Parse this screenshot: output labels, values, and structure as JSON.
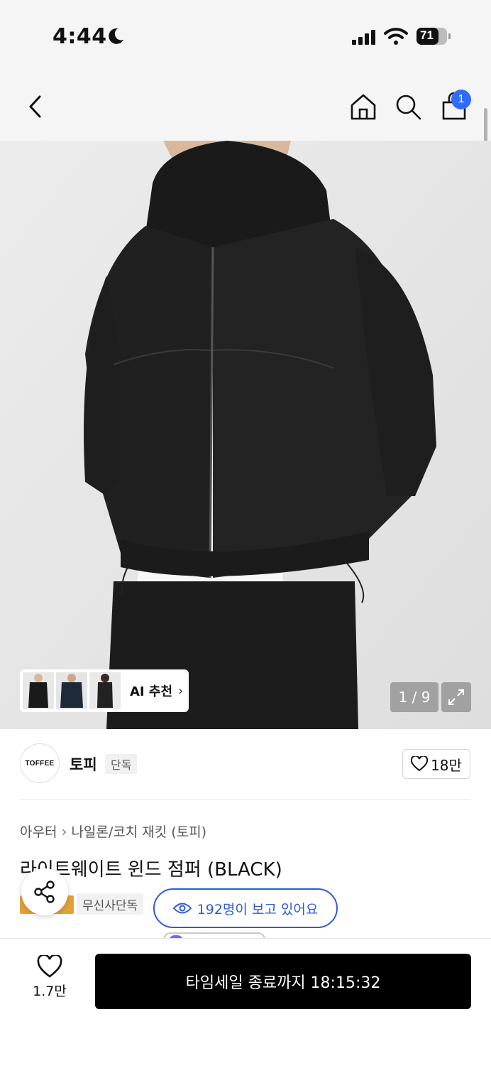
{
  "status_bar": {
    "time": "4:44",
    "battery": "71"
  },
  "header": {
    "cart_count": "1"
  },
  "gallery": {
    "counter": "1 / 9",
    "ai_recommend_label": "AI 추천"
  },
  "brand": {
    "logo_text": "TOFFEE",
    "name": "토피",
    "tag": "단독",
    "likes": "18만"
  },
  "product": {
    "breadcrumb": [
      "아우터",
      "나일론/코치 재킷 (토피)"
    ],
    "title": "라이트웨이트 윈드 점퍼 (BLACK)",
    "exclusive_tag": "무신사단독",
    "viewers": "192명이 보고 있어요"
  },
  "bottom_bar": {
    "like_count": "1.7만",
    "buy_label": "타임세일 종료까지 18:15:32"
  },
  "colors": {
    "accent_blue": "#2f6bff",
    "viewer_blue": "#2f5bd8",
    "gold": "#e3a13a"
  }
}
